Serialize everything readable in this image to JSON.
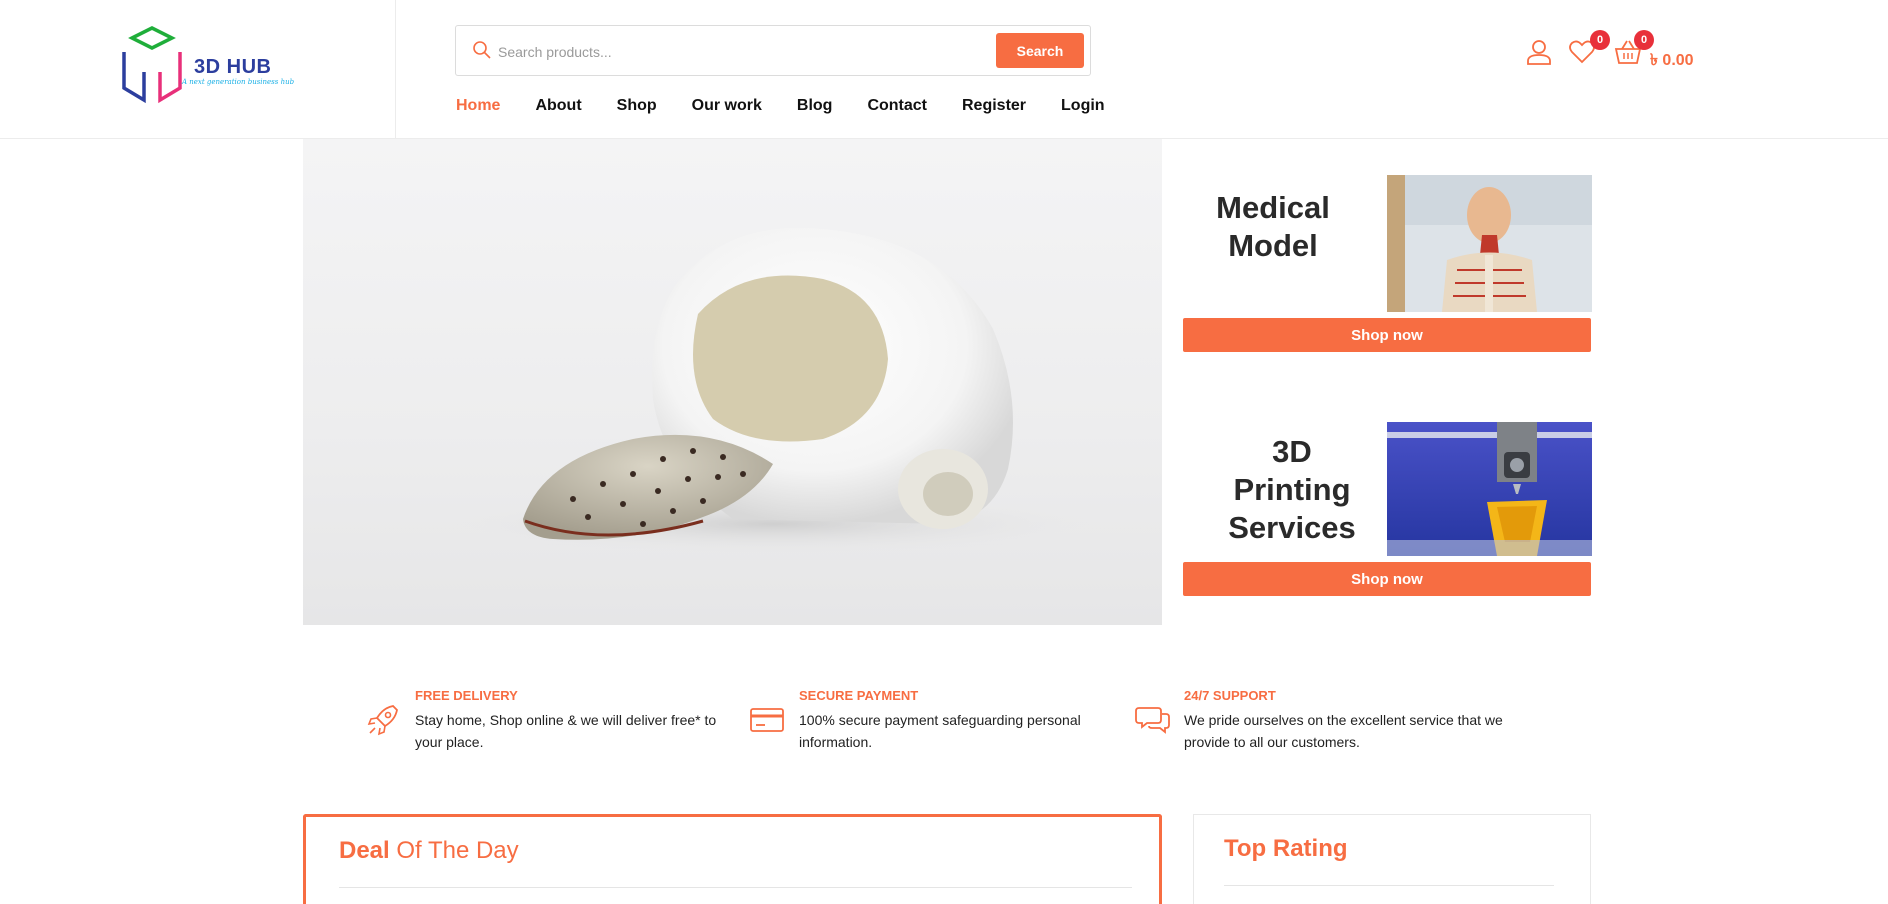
{
  "brand": {
    "name": "3D HUB",
    "tagline": "A next generation business hub",
    "accent_color": "#f76d42"
  },
  "search": {
    "placeholder": "Search products...",
    "value": "",
    "button_label": "Search"
  },
  "nav": {
    "items": [
      {
        "label": "Home",
        "active": true
      },
      {
        "label": "About",
        "active": false
      },
      {
        "label": "Shop",
        "active": false
      },
      {
        "label": "Our work",
        "active": false
      },
      {
        "label": "Blog",
        "active": false
      },
      {
        "label": "Contact",
        "active": false
      },
      {
        "label": "Register",
        "active": false
      },
      {
        "label": "Login",
        "active": false
      }
    ]
  },
  "header_icons": {
    "account_icon": "user-icon",
    "wishlist_icon": "heart-icon",
    "wishlist_count": "0",
    "cart_icon": "basket-icon",
    "cart_count": "0",
    "cart_total": "৳ 0.00"
  },
  "hero": {
    "image": "3d-printed-skull-implant"
  },
  "promos": [
    {
      "title_line1": "Medical",
      "title_line2": "Model",
      "button_label": "Shop now",
      "image": "anatomy-model"
    },
    {
      "title_line1": "3D Printing",
      "title_line2": "Services",
      "button_label": "Shop now",
      "image": "3d-printer-nozzle"
    }
  ],
  "features": [
    {
      "icon": "rocket-icon",
      "title": "FREE DELIVERY",
      "description": "Stay home, Shop online & we will deliver free* to your place."
    },
    {
      "icon": "credit-card-icon",
      "title": "SECURE PAYMENT",
      "description": "100% secure payment safeguarding personal information."
    },
    {
      "icon": "chat-bubbles-icon",
      "title": "24/7 SUPPORT",
      "description": "We pride ourselves on the excellent service that we provide to all our customers."
    }
  ],
  "deal": {
    "title_bold": "Deal",
    "title_rest": " Of The Day"
  },
  "top_rating": {
    "title": "Top Rating"
  }
}
